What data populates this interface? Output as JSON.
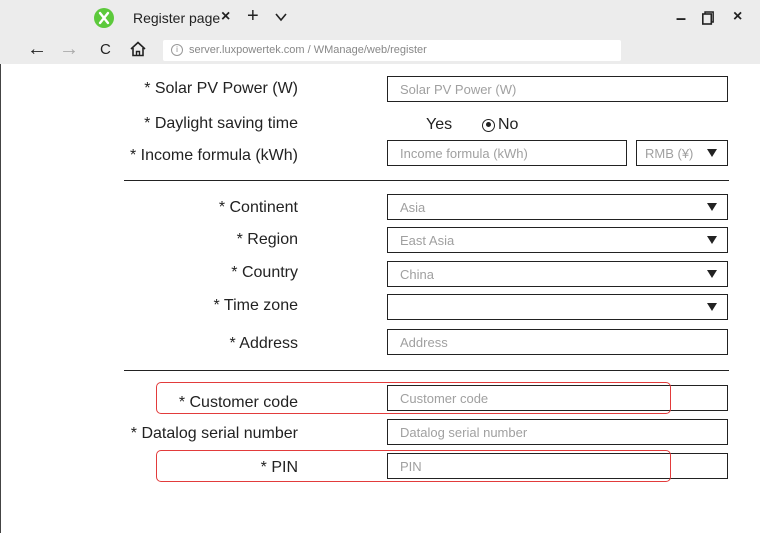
{
  "browser": {
    "tab_title": "Register page",
    "tab_close": "×",
    "new_tab": "+",
    "url": "server.luxpowertek.com / WManage/web/register",
    "info_glyph": "i",
    "back": "←",
    "forward": "→",
    "reload": "C",
    "min": "–",
    "close": "×",
    "brand_color": "#5cc93b"
  },
  "form": {
    "solar_pv_power": {
      "label": "* Solar PV Power (W)",
      "placeholder": "Solar PV Power (W)"
    },
    "daylight_saving": {
      "label": "* Daylight saving time",
      "options": [
        "Yes",
        "No"
      ],
      "selected": "No"
    },
    "income_formula": {
      "label": "* Income formula (kWh)",
      "placeholder": "Income formula (kWh)",
      "currency": "RMB (¥)"
    },
    "continent": {
      "label": "* Continent",
      "value": "Asia"
    },
    "region": {
      "label": "* Region",
      "value": "East Asia"
    },
    "country": {
      "label": "* Country",
      "value": "China"
    },
    "time_zone": {
      "label": "* Time zone",
      "value": ""
    },
    "address": {
      "label": "* Address",
      "placeholder": "Address"
    },
    "customer_code": {
      "label": "* Customer code",
      "placeholder": "Customer code"
    },
    "datalog_serial": {
      "label": "* Datalog serial number",
      "placeholder": "Datalog serial number"
    },
    "pin": {
      "label": "* PIN",
      "placeholder": "PIN"
    }
  },
  "highlight_color": "#e23b3b"
}
